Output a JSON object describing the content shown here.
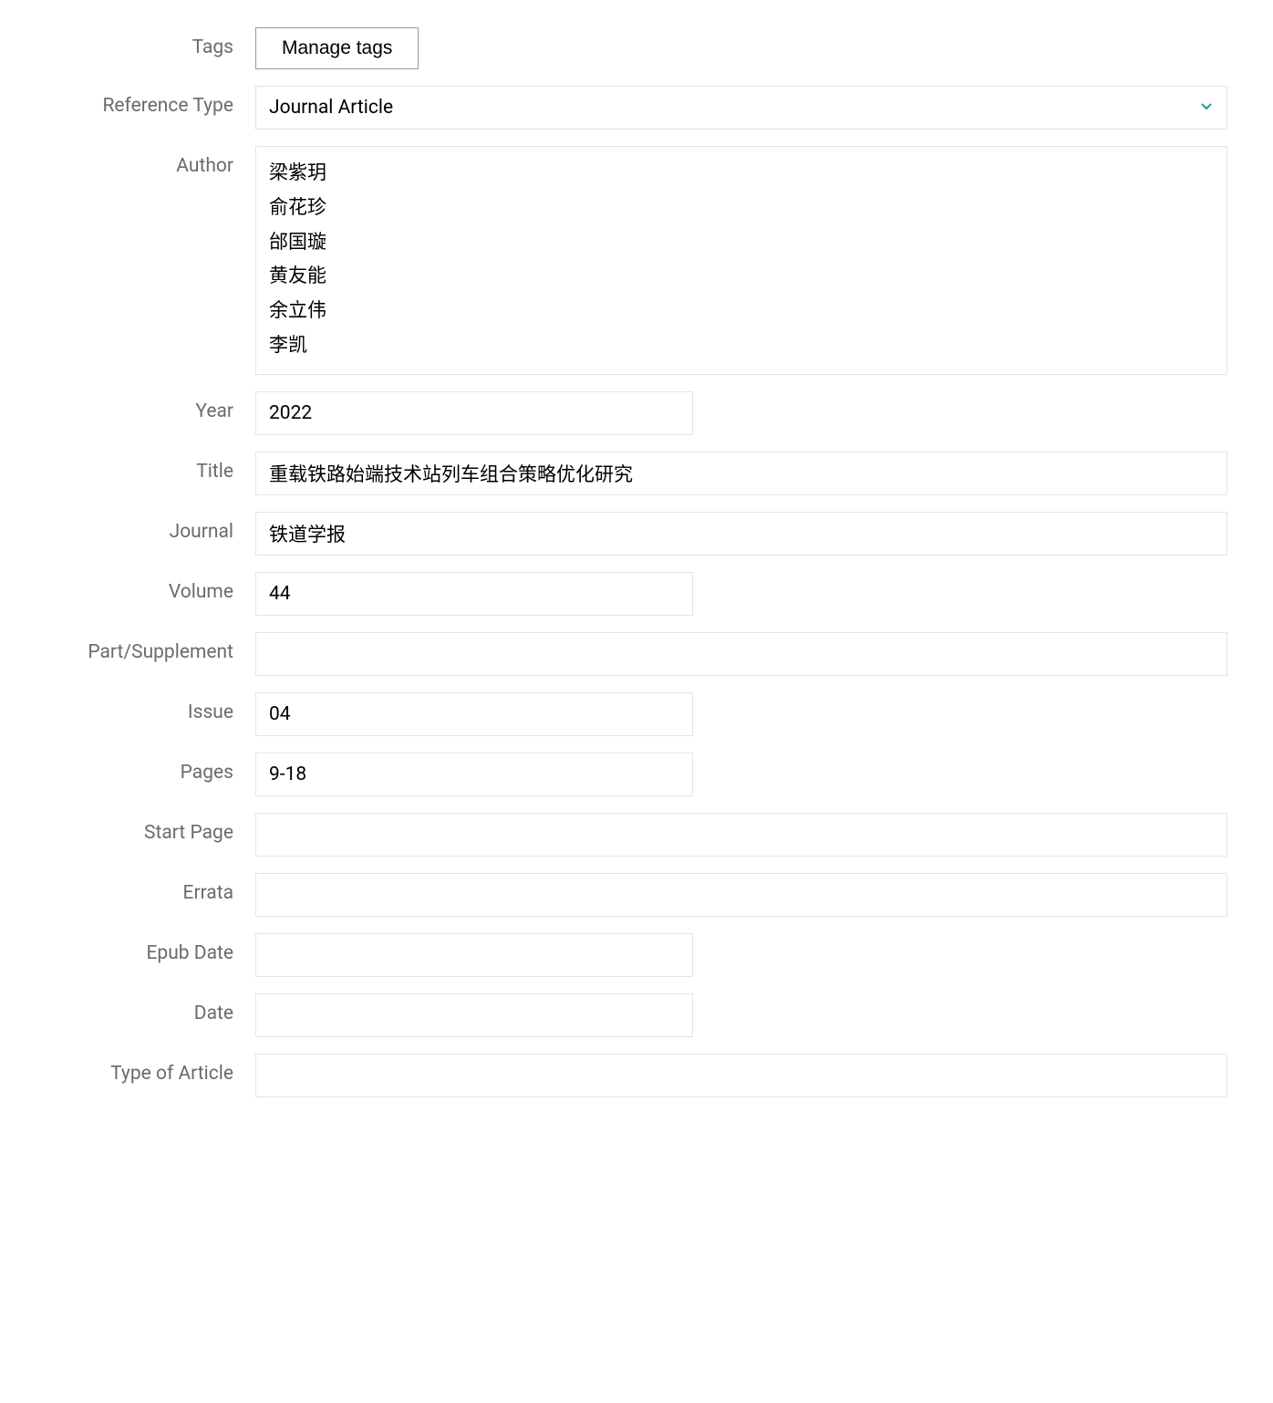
{
  "labels": {
    "tags": "Tags",
    "reference_type": "Reference Type",
    "author": "Author",
    "year": "Year",
    "title": "Title",
    "journal": "Journal",
    "volume": "Volume",
    "part_supplement": "Part/Supplement",
    "issue": "Issue",
    "pages": "Pages",
    "start_page": "Start Page",
    "errata": "Errata",
    "epub_date": "Epub Date",
    "date": "Date",
    "type_of_article": "Type of Article"
  },
  "buttons": {
    "manage_tags": "Manage tags"
  },
  "values": {
    "reference_type": "Journal Article",
    "authors": [
      "梁紫玥",
      "俞花珍",
      "邰国璇",
      "黄友能",
      "余立伟",
      "李凯"
    ],
    "year": "2022",
    "title": "重载铁路始端技术站列车组合策略优化研究",
    "journal": "铁道学报",
    "volume": "44",
    "part_supplement": "",
    "issue": "04",
    "pages": "9-18",
    "start_page": "",
    "errata": "",
    "epub_date": "",
    "date": "",
    "type_of_article": ""
  }
}
